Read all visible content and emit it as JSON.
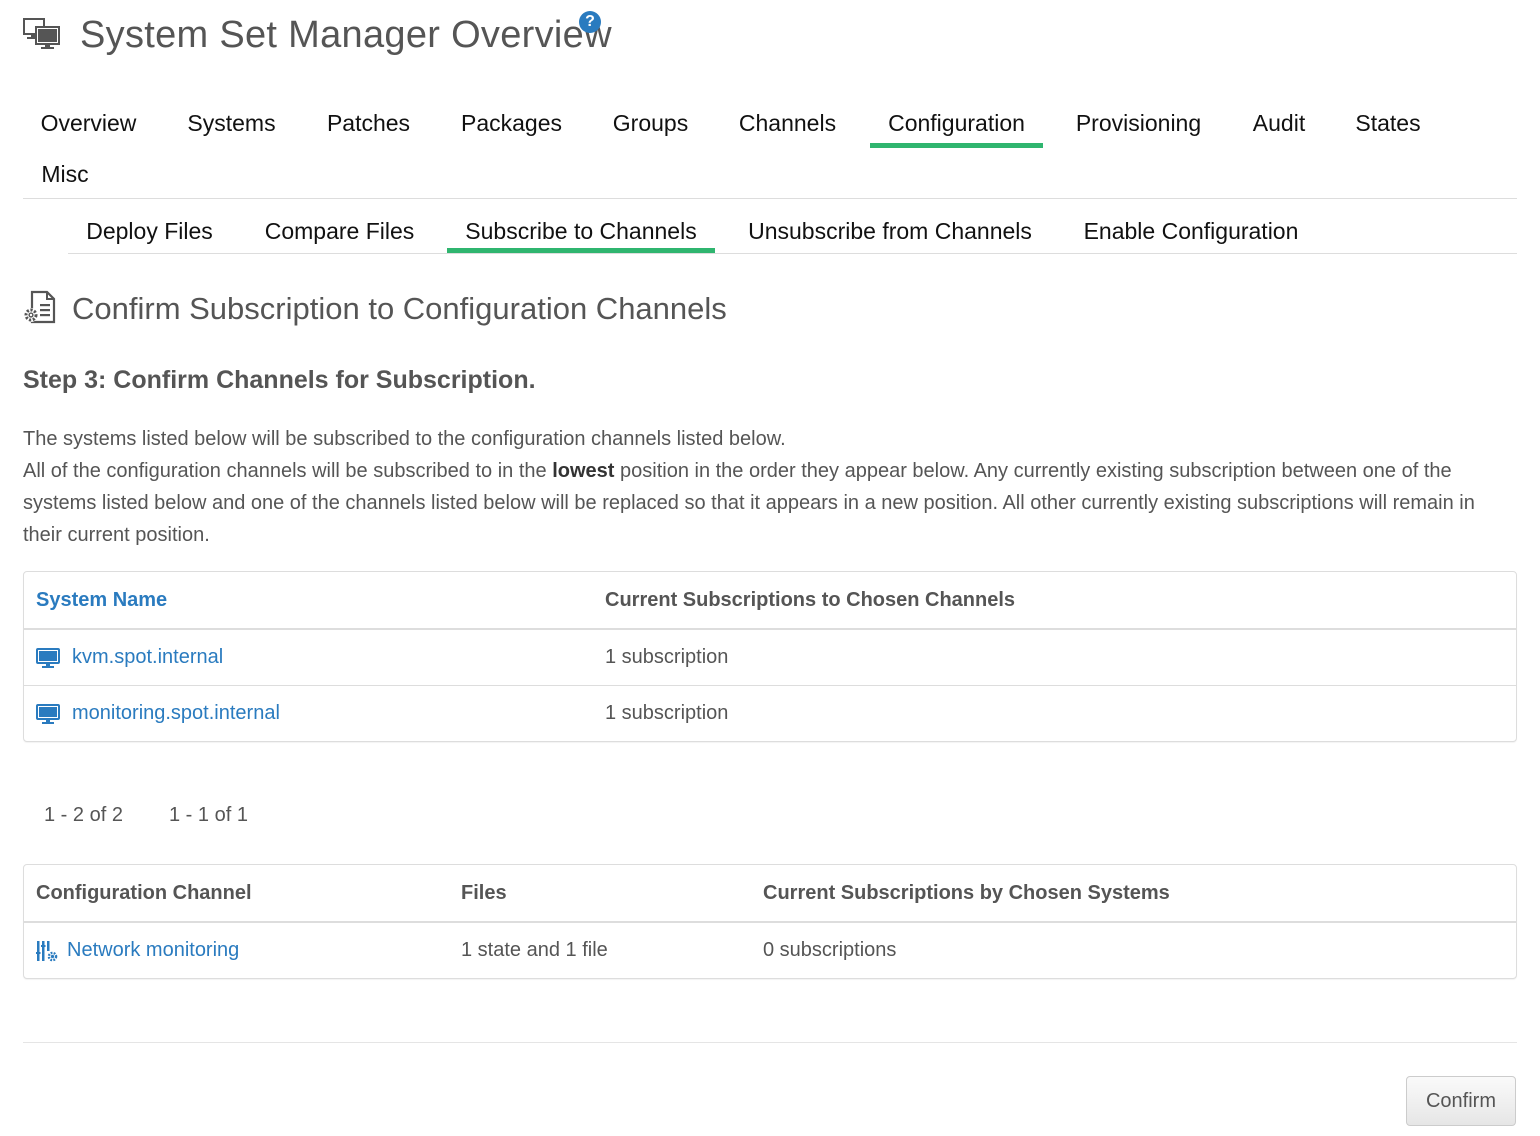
{
  "header": {
    "title": "System Set Manager Overview",
    "help_icon": "question-circle-icon",
    "help_glyph": "?"
  },
  "main_tabs": [
    {
      "label": "Overview",
      "active": false
    },
    {
      "label": "Systems",
      "active": false
    },
    {
      "label": "Patches",
      "active": false
    },
    {
      "label": "Packages",
      "active": false
    },
    {
      "label": "Groups",
      "active": false
    },
    {
      "label": "Channels",
      "active": false
    },
    {
      "label": "Configuration",
      "active": true
    },
    {
      "label": "Provisioning",
      "active": false
    },
    {
      "label": "Audit",
      "active": false
    },
    {
      "label": "States",
      "active": false
    },
    {
      "label": "Misc",
      "active": false
    }
  ],
  "sub_tabs": [
    {
      "label": "Deploy Files",
      "active": false
    },
    {
      "label": "Compare Files",
      "active": false
    },
    {
      "label": "Subscribe to Channels",
      "active": true
    },
    {
      "label": "Unsubscribe from Channels",
      "active": false
    },
    {
      "label": "Enable Configuration",
      "active": false
    }
  ],
  "section": {
    "icon": "config-file-gear-icon",
    "title": "Confirm Subscription to Configuration Channels"
  },
  "step_title": "Step 3: Confirm Channels for Subscription.",
  "description": {
    "line1": "The systems listed below will be subscribed to the configuration channels listed below.",
    "line2_before": "All of the configuration channels will be subscribed to in the ",
    "line2_bold": "lowest",
    "line2_after": " position in the order they appear below. Any currently existing subscription between one of the systems listed below and one of the channels listed below will be replaced so that it appears in a new position. All other currently existing subscriptions will remain in their current position."
  },
  "systems_table": {
    "columns": [
      "System Name",
      "Current Subscriptions to Chosen Channels"
    ],
    "rows": [
      {
        "icon": "desktop-icon",
        "name": "kvm.spot.internal",
        "subscriptions": "1 subscription"
      },
      {
        "icon": "desktop-icon",
        "name": "monitoring.spot.internal",
        "subscriptions": "1 subscription"
      }
    ]
  },
  "pagination": {
    "systems": "1 - 2 of 2",
    "channels": "1 - 1 of 1"
  },
  "channels_table": {
    "columns": [
      "Configuration Channel",
      "Files",
      "Current Subscriptions by Chosen Systems"
    ],
    "rows": [
      {
        "icon": "state-channel-icon",
        "name": "Network monitoring",
        "files": "1 state and 1 file",
        "subscriptions": "0 subscriptions"
      }
    ]
  },
  "confirm_label": "Confirm",
  "colors": {
    "accent_green": "#2fb56f",
    "link_blue": "#2a7bbf",
    "text_gray": "#555555"
  }
}
